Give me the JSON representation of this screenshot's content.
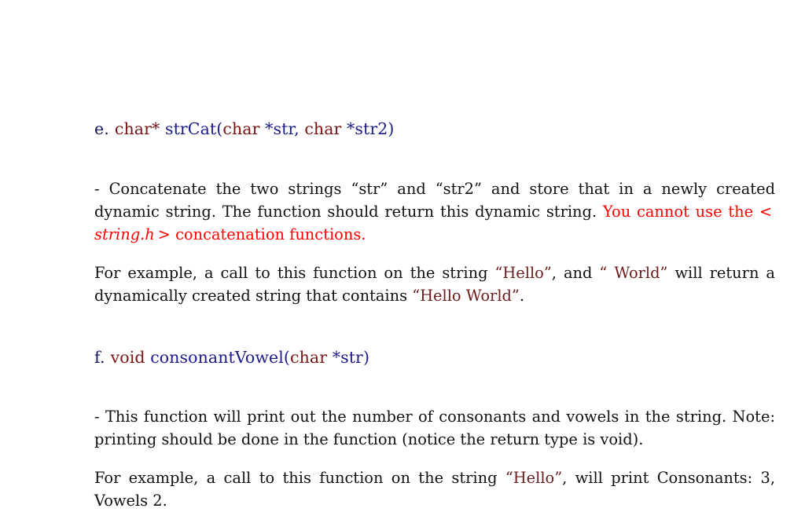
{
  "document": {
    "type": "assignment-questions",
    "background_color": "#ffffff",
    "colors": {
      "body_text": "#111111",
      "type_keyword": "#7a1515",
      "identifier": "#1b1b8a",
      "emphasis_red": "#ff0000",
      "string_literal": "#6b1c1c",
      "list_marker": "#16165f"
    }
  },
  "items": [
    {
      "id": "item-e",
      "marker": "e.",
      "prototype": {
        "return_type": "char*",
        "name": "strCat",
        "open_paren": "(",
        "params": [
          {
            "type": "char",
            "name": "*str"
          },
          {
            "type": "char",
            "name": "*str2"
          }
        ],
        "separator": ", ",
        "close_paren": ")"
      },
      "description": {
        "dash": "-",
        "text_before_red": "Concatenate the two strings “str” and “str2” and store that in a newly created dynamic string. The function should return this dynamic string. ",
        "red_before_italic": "You cannot use the < ",
        "red_italic": "string.h",
        "red_after_italic": " > concatenation functions."
      },
      "example": {
        "lead": "For example, a call to this function on the string ",
        "literal_1": "“Hello”",
        "middle": ", and ",
        "literal_2": "“ World”",
        "tail": " will return a dynamically created string that contains ",
        "literal_3": "“Hello World”",
        "end": "."
      }
    },
    {
      "id": "item-f",
      "marker": "f.",
      "prototype": {
        "return_type": "void",
        "name": "consonantVowel",
        "open_paren": "(",
        "params": [
          {
            "type": "char",
            "name": "*str"
          }
        ],
        "separator": ", ",
        "close_paren": ")"
      },
      "description": {
        "dash": "-",
        "text": "This function will print out the number of consonants and vowels in the string. Note: printing should be done in the function (notice the return type is void)."
      },
      "example": {
        "lead": "For example, a call to this function on the string ",
        "literal_1": "“Hello”",
        "tail": ", will print Consonants: 3, Vowels 2."
      }
    }
  ]
}
